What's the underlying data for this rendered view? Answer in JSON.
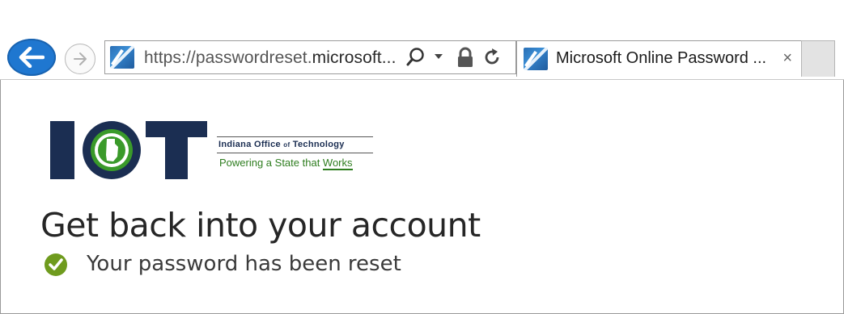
{
  "browser": {
    "url_prefix": "https://passwordreset.",
    "url_domain": "microsoft...",
    "tab_title": "Microsoft Online Password ...",
    "tab_close": "×"
  },
  "logo": {
    "letters": "IOT",
    "org_name_a": "Indiana Office ",
    "org_name_of": "of",
    "org_name_b": " Technology",
    "tagline": "Powering a State that ",
    "tagline_emphasis": "Works"
  },
  "page": {
    "title": "Get back into your account",
    "status": "Your password has been reset"
  },
  "colors": {
    "back_button": "#1f77d0",
    "logo_navy": "#1b2e52",
    "logo_green": "#3a9a2a",
    "check_green": "#6f9b1e"
  }
}
